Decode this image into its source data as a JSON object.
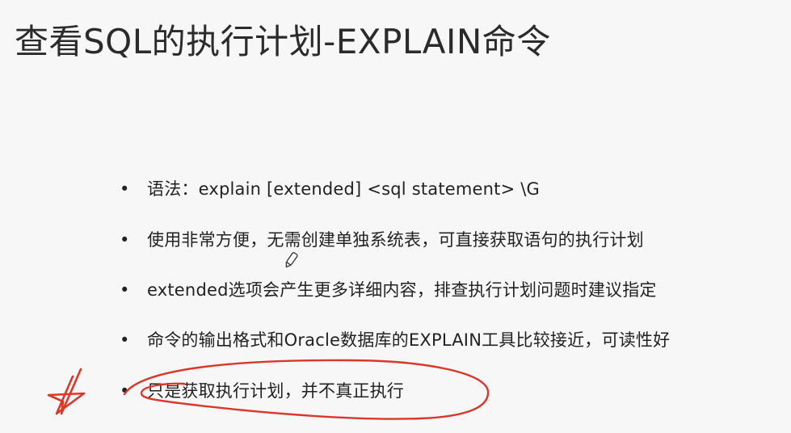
{
  "slide": {
    "title": "查看SQL的执行计划-EXPLAIN命令"
  },
  "bullets": [
    {
      "marker": "•",
      "text": "语法：explain [extended] <sql statement> \\G"
    },
    {
      "marker": "•",
      "text": "使用非常方便，无需创建单独系统表，可直接获取语句的执行计划"
    },
    {
      "marker": "•",
      "text": "extended选项会产生更多详细内容，排查执行计划问题时建议指定"
    },
    {
      "marker": "•",
      "text": "命令的输出格式和Oracle数据库的EXPLAIN工具比较接近，可读性好"
    },
    {
      "marker": "•",
      "text": "只是获取执行计划，并不真正执行"
    }
  ],
  "annotations": {
    "ink_color": "#d9382b",
    "pen_cursor_icon": "pen-cursor-icon",
    "star_icon": "hand-drawn-star-icon"
  }
}
